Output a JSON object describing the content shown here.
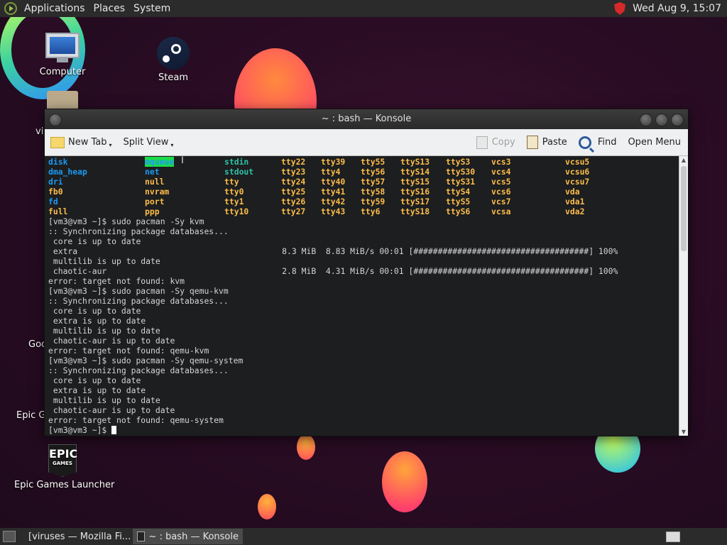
{
  "top_panel": {
    "menus": [
      "Applications",
      "Places",
      "System"
    ],
    "clock": "Wed Aug  9, 15:07"
  },
  "desktop": {
    "icons": {
      "computer": "Computer",
      "steam": "Steam",
      "epic": "Epic Games Launcher",
      "epic_logo_line1": "EPIC",
      "epic_logo_line2": "GAMES"
    },
    "partial_labels": {
      "folder": "vi",
      "goo": "Goo",
      "epic_g": "Epic G"
    }
  },
  "konsole": {
    "title": "~ : bash — Konsole",
    "toolbar": {
      "new_tab": "New Tab",
      "split_view": "Split View",
      "copy": "Copy",
      "paste": "Paste",
      "find": "Find",
      "open_menu": "Open Menu"
    },
    "device_rows": [
      [
        "disk",
        "mqueue",
        "stdin",
        "tty22",
        "tty39",
        "tty55",
        "ttyS13",
        "ttyS3",
        "vcs3",
        "vcsu5"
      ],
      [
        "dma_heap",
        "net",
        "stdout",
        "tty23",
        "tty4",
        "tty56",
        "ttyS14",
        "ttyS30",
        "vcs4",
        "vcsu6"
      ],
      [
        "dri",
        "null",
        "tty",
        "tty24",
        "tty40",
        "tty57",
        "ttyS15",
        "ttyS31",
        "vcs5",
        "vcsu7"
      ],
      [
        "fb0",
        "nvram",
        "tty0",
        "tty25",
        "tty41",
        "tty58",
        "ttyS16",
        "ttyS4",
        "vcs6",
        "vda"
      ],
      [
        "fd",
        "port",
        "tty1",
        "tty26",
        "tty42",
        "tty59",
        "ttyS17",
        "ttyS5",
        "vcs7",
        "vda1"
      ],
      [
        "full",
        "ppp",
        "tty10",
        "tty27",
        "tty43",
        "tty6",
        "ttyS18",
        "ttyS6",
        "vcsa",
        "vda2"
      ]
    ],
    "output_lines": [
      "[vm3@vm3 ~]$ sudo pacman -Sy kvm",
      ":: Synchronizing package databases...",
      " core is up to date",
      " extra                                          8.3 MiB  8.83 MiB/s 00:01 [####################################] 100%",
      " multilib is up to date",
      " chaotic-aur                                    2.8 MiB  4.31 MiB/s 00:01 [####################################] 100%",
      "error: target not found: kvm",
      "[vm3@vm3 ~]$ sudo pacman -Sy qemu-kvm",
      ":: Synchronizing package databases...",
      " core is up to date",
      " extra is up to date",
      " multilib is up to date",
      " chaotic-aur is up to date",
      "error: target not found: qemu-kvm",
      "[vm3@vm3 ~]$ sudo pacman -Sy qemu-system",
      ":: Synchronizing package databases...",
      " core is up to date",
      " extra is up to date",
      " multilib is up to date",
      " chaotic-aur is up to date",
      "error: target not found: qemu-system"
    ],
    "prompt": "[vm3@vm3 ~]$ "
  },
  "taskbar": {
    "tasks": [
      "[viruses — Mozilla Fi...",
      "~ : bash — Konsole"
    ]
  }
}
